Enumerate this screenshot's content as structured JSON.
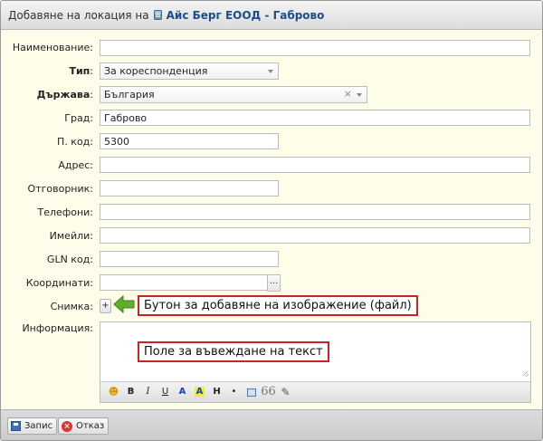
{
  "dialog": {
    "title_prefix": "Добавяне на локация на",
    "company": "Айс Берг ЕООД - Габрово"
  },
  "form": {
    "name": {
      "label": "Наименование:",
      "value": ""
    },
    "type": {
      "label": "Тип",
      "value": "За кореспонденция"
    },
    "country": {
      "label": "Държава",
      "value": "България"
    },
    "city": {
      "label": "Град:",
      "value": "Габрово"
    },
    "postcode": {
      "label": "П. код:",
      "value": "5300"
    },
    "address": {
      "label": "Адрес:",
      "value": ""
    },
    "responsible": {
      "label": "Отговорник:",
      "value": ""
    },
    "phones": {
      "label": "Телефони:",
      "value": ""
    },
    "emails": {
      "label": "Имейли:",
      "value": ""
    },
    "gln": {
      "label": "GLN код:",
      "value": ""
    },
    "coordinates": {
      "label": "Координати:",
      "value": "",
      "button": "..."
    },
    "image": {
      "label": "Снимка:",
      "add_button": "+"
    },
    "info": {
      "label": "Информация:",
      "value": ""
    }
  },
  "annotations": {
    "image_button": "Бутон за добавяне на изображение (файл)",
    "text_field": "Поле за въвеждане на текст"
  },
  "editor_toolbar": {
    "bold": "B",
    "italic": "I",
    "underline": "U",
    "font_color": "A",
    "highlight": "A",
    "heading": "H",
    "list": "•",
    "quote": "66"
  },
  "footer": {
    "save_label": "Запис",
    "cancel_label": "Отказ"
  },
  "colors": {
    "form_bg": "#fdfde9",
    "company_link": "#1d4d8a",
    "annotation_border": "#cc2222",
    "arrow_green": "#5fae2a"
  },
  "colon": ":"
}
